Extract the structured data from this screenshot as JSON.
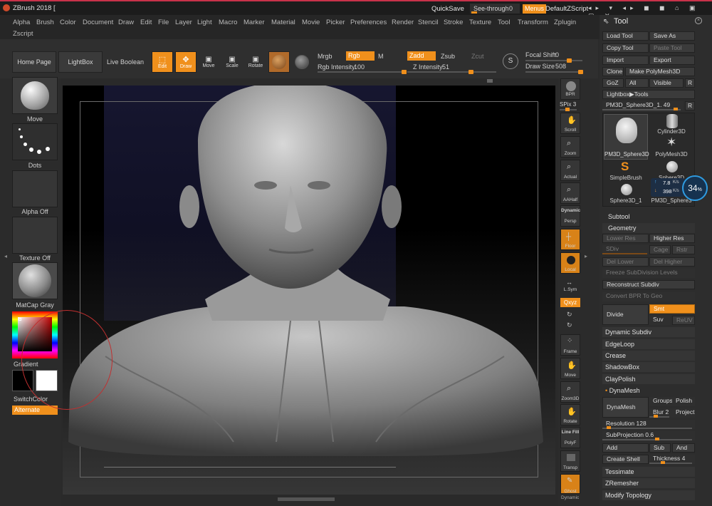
{
  "titlebar": {
    "app_title": "ZBrush 2018 [",
    "quicksave": "QuickSave",
    "see_through": "See-through",
    "see_through_value": "0",
    "menus": "Menus",
    "default_zscript": "DefaultZScript"
  },
  "menubar": {
    "items": [
      "Alpha",
      "Brush",
      "Color",
      "Document",
      "Draw",
      "Edit",
      "File",
      "Layer",
      "Light",
      "Macro",
      "Marker",
      "Material",
      "Movie",
      "Picker",
      "Preferences",
      "Render",
      "Stencil",
      "Stroke",
      "Texture",
      "Tool",
      "Transform",
      "Zplugin"
    ],
    "second_row": "Zscript"
  },
  "toolbar": {
    "home_page": "Home Page",
    "lightbox": "LightBox",
    "live_boolean": "Live Boolean",
    "edit": "Edit",
    "draw": "Draw",
    "move": "Move",
    "scale": "Scale",
    "rotate": "Rotate",
    "mrgb": "Mrgb",
    "rgb": "Rgb",
    "m": "M",
    "rgb_intensity_label": "Rgb Intensity",
    "rgb_intensity_value": "100",
    "zadd": "Zadd",
    "zsub": "Zsub",
    "zcut": "Zcut",
    "z_intensity_label": "Z Intensity",
    "z_intensity_value": "51",
    "focal_shift_label": "Focal Shift",
    "focal_shift_value": "0",
    "draw_size_label": "Draw Size",
    "draw_size_value": "508"
  },
  "left_shelf": {
    "brush": "Move",
    "stroke": "Dots",
    "alpha": "Alpha Off",
    "texture": "Texture Off",
    "material": "MatCap Gray",
    "gradient": "Gradient",
    "switch_color": "SwitchColor",
    "alternate": "Alternate"
  },
  "right_shelf": {
    "bpr": "BPR",
    "spix_label": "SPix",
    "spix_value": "3",
    "scroll": "Scroll",
    "zoom": "Zoom",
    "actual": "Actual",
    "aahalf": "AAHalf",
    "dynamic": "Dynamic",
    "persp": "Persp",
    "floor": "Floor",
    "local": "Local",
    "lsym": "L.Sym",
    "xyz": "Qxyz",
    "frame": "Frame",
    "move": "Move",
    "zoom3d": "Zoom3D",
    "rotate": "Rotate",
    "line_fill": "Line Fill",
    "polyf": "PolyF",
    "transp": "Transp",
    "ghost": "Ghost",
    "dynamic2": "Dynamic"
  },
  "tool_panel": {
    "header": "Tool",
    "load_tool": "Load Tool",
    "save_as": "Save As",
    "copy_tool": "Copy Tool",
    "paste_tool": "Paste Tool",
    "import": "Import",
    "export": "Export",
    "clone": "Clone",
    "make_polymesh": "Make PolyMesh3D",
    "goz": "GoZ",
    "all": "All",
    "visible": "Visible",
    "r": "R",
    "lightbox_tools": "Lightbox▶Tools",
    "current_tool": "PM3D_Sphere3D_1. 49",
    "tools": [
      "PM3D_Sphere3D",
      "Cylinder3D",
      "PolyMesh3D",
      "SimpleBrush",
      "Sphere3D",
      "Sphere3D_1",
      "PM3D_Sphere3"
    ],
    "net_up": "7.8",
    "net_down": "398",
    "net_unit": "K/s",
    "net_percent": "34",
    "net_percent_unit": "%",
    "subtool": "Subtool",
    "geometry": "Geometry",
    "lower_res": "Lower Res",
    "higher_res": "Higher Res",
    "sdiv": "SDiv",
    "cage": "Cage",
    "rstr": "Rstr",
    "del_lower": "Del Lower",
    "del_higher": "Del Higher",
    "freeze_subdiv": "Freeze SubDivision Levels",
    "reconstruct_subdiv": "Reconstruct Subdiv",
    "convert_bpr": "Convert BPR To Geo",
    "divide": "Divide",
    "smt": "Smt",
    "suv": "Suv",
    "reuv": "ReUV",
    "dynamic_subdiv": "Dynamic Subdiv",
    "edgeloop": "EdgeLoop",
    "crease": "Crease",
    "shadowbox": "ShadowBox",
    "claypolish": "ClayPolish",
    "dynamesh_header": "DynaMesh",
    "dynamesh": "DynaMesh",
    "groups": "Groups",
    "polish": "Polish",
    "blur_label": "Blur",
    "blur_value": "2",
    "project": "Project",
    "resolution_label": "Resolution",
    "resolution_value": "128",
    "subprojection_label": "SubProjection",
    "subprojection_value": "0.6",
    "add": "Add",
    "sub": "Sub",
    "and": "And",
    "create_shell": "Create Shell",
    "thickness_label": "Thickness",
    "thickness_value": "4",
    "tessimate": "Tessimate",
    "zremesher": "ZRemesher",
    "modify_topology": "Modify Topology"
  }
}
